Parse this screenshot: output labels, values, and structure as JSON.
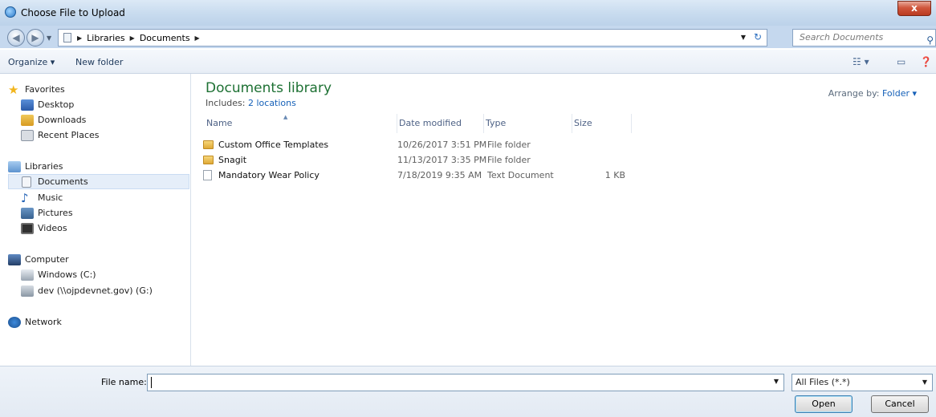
{
  "window": {
    "title": "Choose File to Upload",
    "close_glyph": "x"
  },
  "address": {
    "breadcrumb": [
      "Libraries",
      "Documents"
    ],
    "search_placeholder": "Search Documents"
  },
  "toolbar": {
    "organize_label": "Organize ▾",
    "new_folder_label": "New folder"
  },
  "nav": {
    "favorites": {
      "label": "Favorites",
      "items": [
        "Desktop",
        "Downloads",
        "Recent Places"
      ]
    },
    "libraries": {
      "label": "Libraries",
      "items": [
        "Documents",
        "Music",
        "Pictures",
        "Videos"
      ],
      "selected": "Documents"
    },
    "computer": {
      "label": "Computer",
      "items": [
        "Windows (C:)",
        "dev (\\\\ojpdevnet.gov) (G:)"
      ]
    },
    "network": {
      "label": "Network"
    }
  },
  "library": {
    "title": "Documents library",
    "includes_prefix": "Includes: ",
    "includes_link": "2 locations",
    "arrange_prefix": "Arrange by:",
    "arrange_value": "Folder ▾"
  },
  "columns": {
    "name": "Name",
    "date": "Date modified",
    "type": "Type",
    "size": "Size"
  },
  "files": [
    {
      "name": "Custom Office Templates",
      "date": "10/26/2017 3:51 PM",
      "type": "File folder",
      "size": "",
      "icon": "folder-icon"
    },
    {
      "name": "Snagit",
      "date": "11/13/2017 3:35 PM",
      "type": "File folder",
      "size": "",
      "icon": "folder-icon"
    },
    {
      "name": "Mandatory Wear Policy",
      "date": "7/18/2019 9:35 AM",
      "type": "Text Document",
      "size": "1 KB",
      "icon": "text-file-icon"
    }
  ],
  "footer": {
    "file_name_label": "File name:",
    "file_name_value": "",
    "filter_value": "All Files (*.*)",
    "open_label": "Open",
    "cancel_label": "Cancel"
  }
}
